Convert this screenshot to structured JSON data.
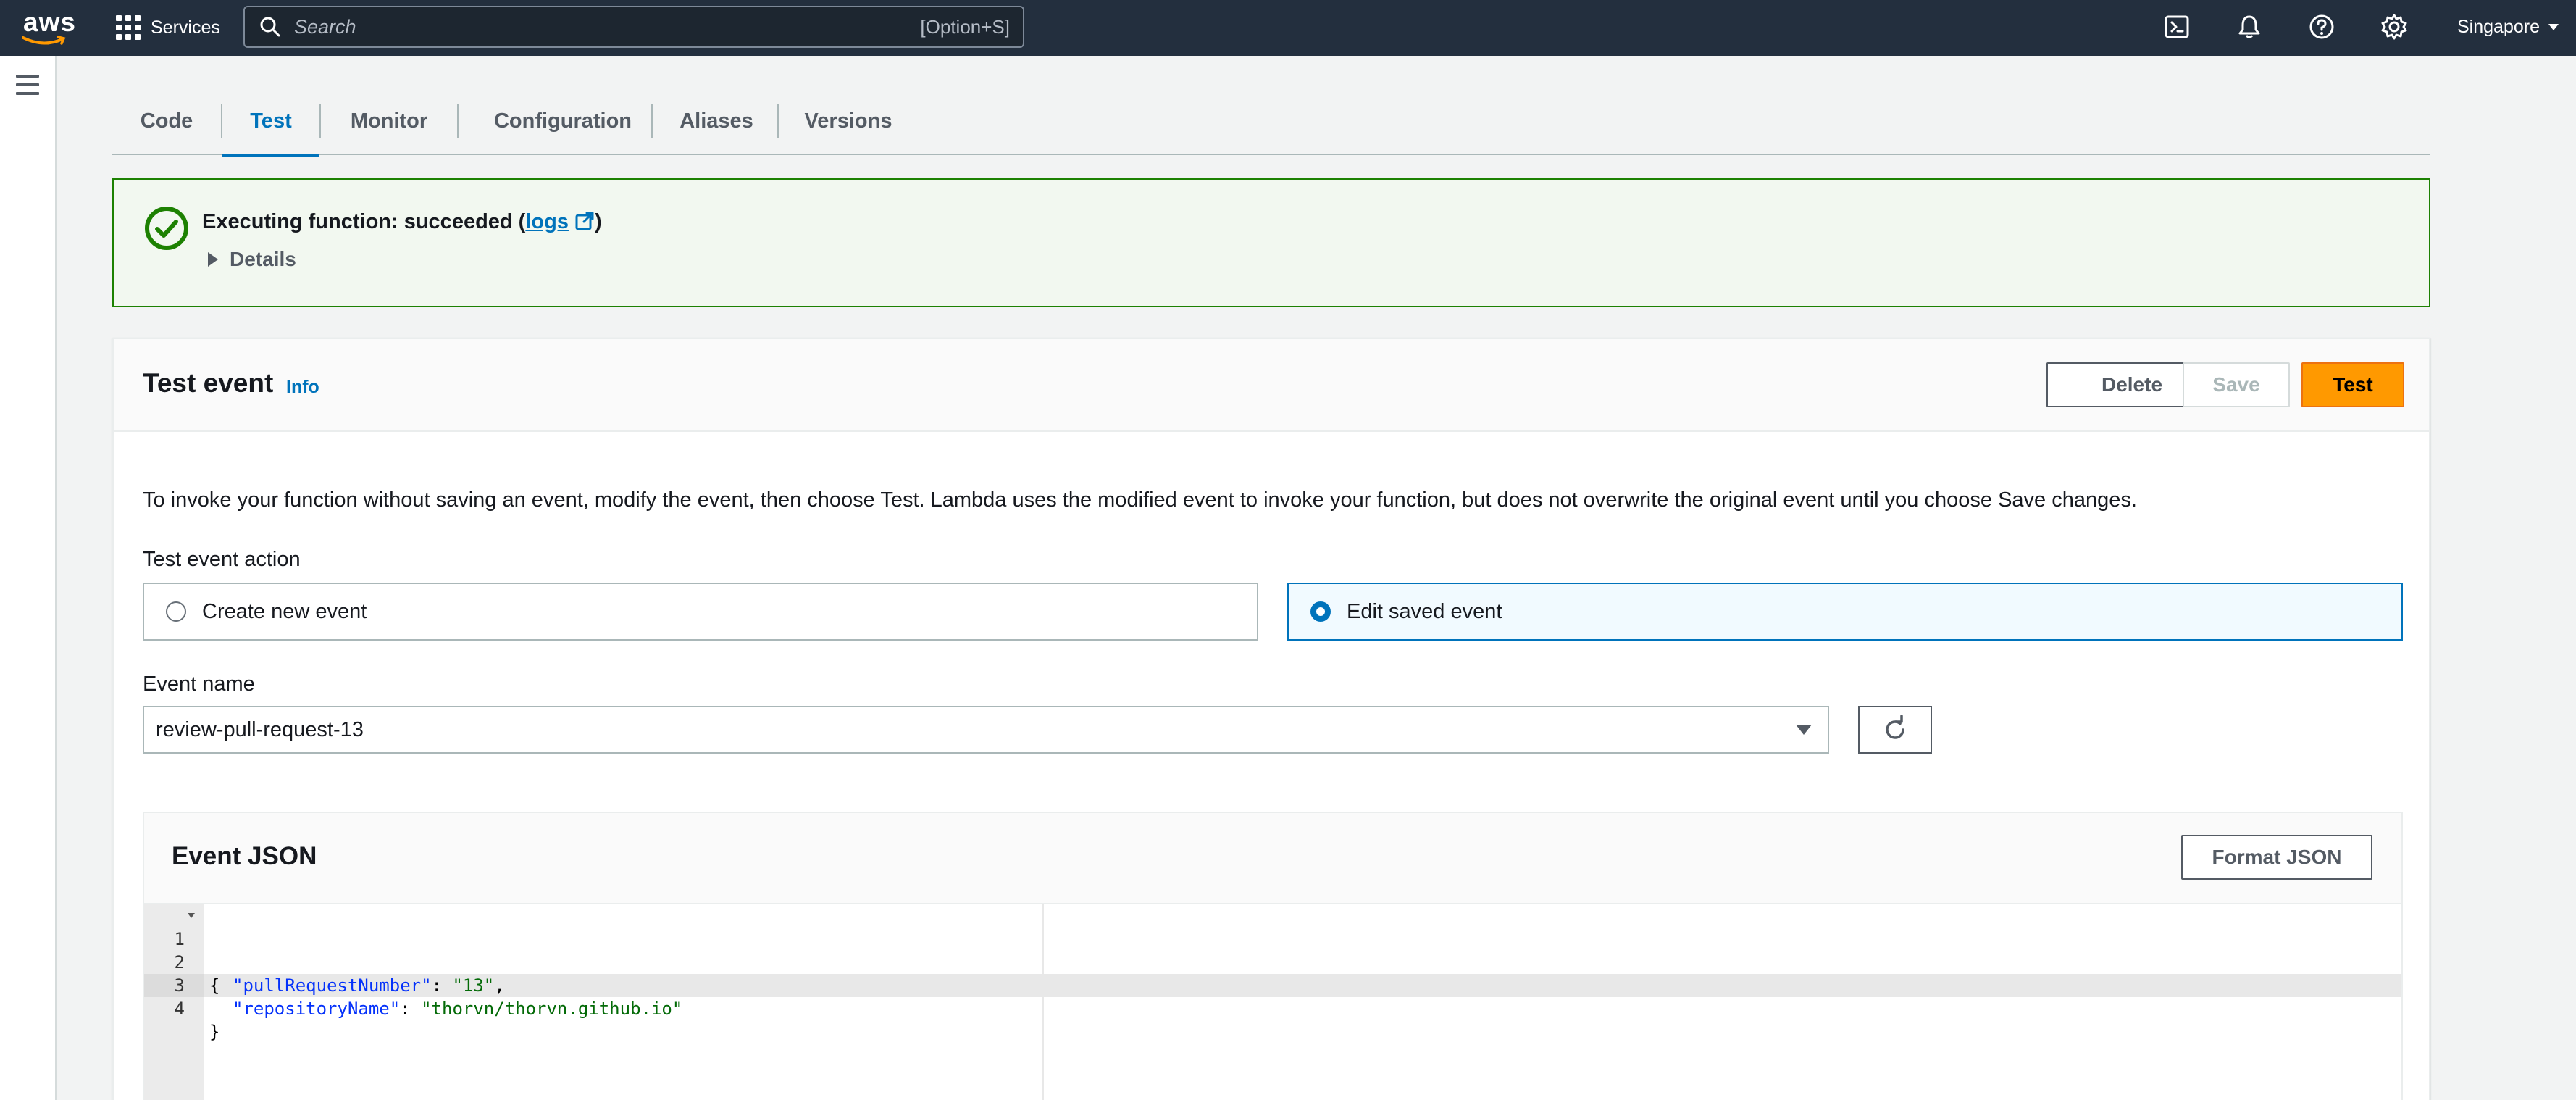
{
  "topnav": {
    "logo_text": "aws",
    "services_label": "Services",
    "search_placeholder": "Search",
    "search_shortcut": "[Option+S]",
    "region": "Singapore"
  },
  "tabs": [
    {
      "label": "Code"
    },
    {
      "label": "Test",
      "active": true
    },
    {
      "label": "Monitor"
    },
    {
      "label": "Configuration"
    },
    {
      "label": "Aliases"
    },
    {
      "label": "Versions"
    }
  ],
  "flash": {
    "title_prefix": "Executing function: succeeded (",
    "logs_link": "logs",
    "title_suffix": ")",
    "details_label": "Details",
    "status_color": "#1d8102"
  },
  "test_event": {
    "title": "Test event",
    "info": "Info",
    "delete_label": "Delete",
    "save_label": "Save",
    "test_label": "Test",
    "description": "To invoke your function without saving an event, modify the event, then choose Test. Lambda uses the modified event to invoke your function, but does not overwrite the original event until you choose Save changes.",
    "action_label": "Test event action",
    "options": [
      {
        "label": "Create new event",
        "selected": false
      },
      {
        "label": "Edit saved event",
        "selected": true
      }
    ],
    "event_name_label": "Event name",
    "event_name_value": "review-pull-request-13"
  },
  "event_json": {
    "title": "Event JSON",
    "format_label": "Format JSON",
    "lines": [
      {
        "n": "1",
        "text": "{"
      },
      {
        "n": "2",
        "key": "\"pullRequestNumber\"",
        "sep": ": ",
        "value": "\"13\"",
        "end": ","
      },
      {
        "n": "3",
        "key": "\"repositoryName\"",
        "sep": ": ",
        "value": "\"thorvn/thorvn.github.io\"",
        "end": ""
      },
      {
        "n": "4",
        "text": "}"
      }
    ]
  },
  "colors": {
    "nav_bg": "#232f3e",
    "accent_blue": "#0073bb",
    "primary_orange": "#ff9900",
    "success_green": "#1d8102"
  }
}
